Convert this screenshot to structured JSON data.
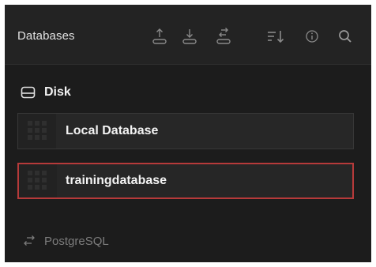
{
  "header": {
    "title": "Databases",
    "actions": [
      {
        "name": "upload-icon"
      },
      {
        "name": "download-icon"
      },
      {
        "name": "switch-icon"
      },
      {
        "name": "sort-icon"
      },
      {
        "name": "info-icon"
      },
      {
        "name": "search-icon"
      }
    ]
  },
  "disk": {
    "title": "Disk",
    "icon": "drive-icon",
    "items": [
      {
        "label": "Local Database",
        "selected": false
      },
      {
        "label": "trainingdatabase",
        "selected": true
      }
    ]
  },
  "postgres": {
    "label": "PostgreSQL",
    "icon": "arrows-exchange-icon"
  },
  "colors": {
    "background": "#1c1c1c",
    "header": "#232323",
    "selected_border": "#b63a3a",
    "text": "#f3f3f3",
    "muted_text": "#7c7c7c"
  }
}
